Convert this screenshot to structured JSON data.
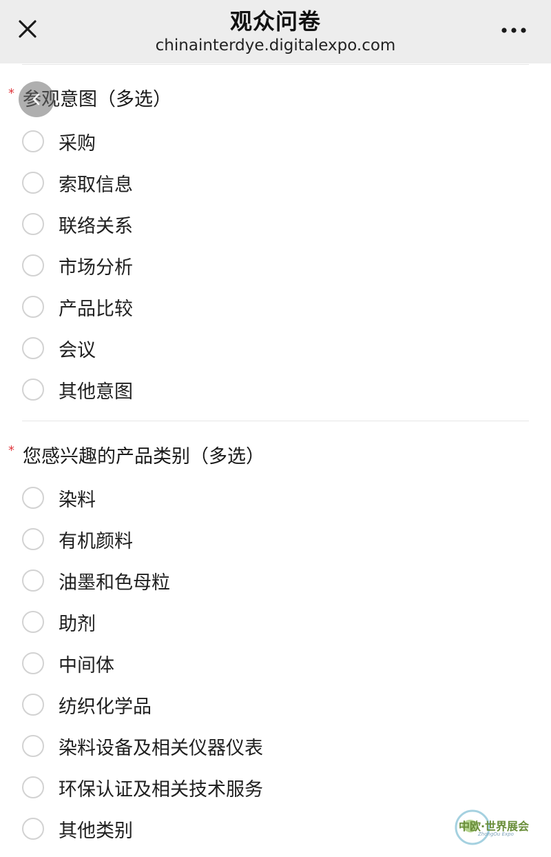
{
  "header": {
    "title": "观众问卷",
    "url": "chinainterdye.digitalexpo.com",
    "close_icon": "close-icon",
    "more_icon": "more-icon"
  },
  "questions": [
    {
      "required_mark": "*",
      "label": "参观意图（多选）",
      "options": [
        "采购",
        "索取信息",
        "联络关系",
        "市场分析",
        "产品比较",
        "会议",
        "其他意图"
      ]
    },
    {
      "required_mark": "*",
      "label": "您感兴趣的产品类别（多选）",
      "options": [
        "染料",
        "有机颜料",
        "油墨和色母粒",
        "助剂",
        "中间体",
        "纺织化学品",
        "染料设备及相关仪器仪表",
        "环保认证及相关技术服务",
        "其他类别"
      ]
    }
  ],
  "logo": {
    "text": "中欧·世界展会",
    "subtext": "ZhongOu Expo"
  },
  "colors": {
    "topbar_bg": "#ededed",
    "required": "#e0383e",
    "radio_border": "#d2d2d2"
  }
}
